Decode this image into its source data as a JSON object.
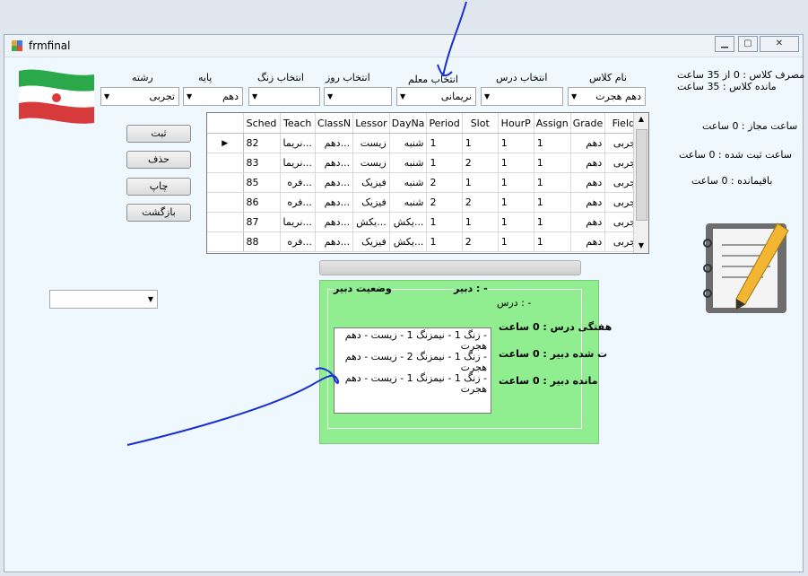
{
  "window": {
    "title": "frmfinal"
  },
  "top_labels": {
    "field": "رشته",
    "grade": "پایه",
    "bell": "انتخاب زنگ",
    "day": "انتخاب روز",
    "teacher": "انتخاب معلم",
    "lesson": "انتخاب درس",
    "class_name": "نام کلاس"
  },
  "combos": {
    "field": "تجربی",
    "grade": "دهم",
    "bell": "",
    "day": "",
    "teacher": "نریمانی",
    "lesson": "",
    "class_name": "دهم هجرت",
    "left_bottom": ""
  },
  "info": {
    "usage": "مصرف کلاس : 0 از 35 ساعت",
    "remaining_class": "مانده کلاس : 35 ساعت",
    "allowed_hours": "ساعت مجاز : 0 ساعت",
    "registered_hours": "ساعت ثبت شده : 0 ساعت",
    "remaining_hours": "باقیمانده : 0 ساعت"
  },
  "buttons": {
    "save": "ثبت",
    "delete": "حذف",
    "print": "چاپ",
    "back": "بازگشت"
  },
  "grid": {
    "columns": [
      "Sched",
      "Teach",
      "ClassN",
      "Lessor",
      "DayNa",
      "Period",
      "Slot",
      "HourP",
      "Assign",
      "Grade",
      "Field"
    ],
    "rows": [
      [
        "82",
        "...نریما",
        "...دهم",
        "زیست",
        "شنبه",
        "1",
        "1",
        "1",
        "1",
        "دهم",
        "تجربی"
      ],
      [
        "83",
        "...نریما",
        "...دهم",
        "زیست",
        "شنبه",
        "1",
        "2",
        "1",
        "1",
        "دهم",
        "تجربی"
      ],
      [
        "85",
        "...فره",
        "...دهم",
        "فیزیک",
        "شنبه",
        "2",
        "1",
        "1",
        "1",
        "دهم",
        "تجربی"
      ],
      [
        "86",
        "...فره",
        "...دهم",
        "فیزیک",
        "شنبه",
        "2",
        "2",
        "1",
        "1",
        "دهم",
        "تجربی"
      ],
      [
        "87",
        "...نریما",
        "...دهم",
        "...یکش",
        "...یکش",
        "1",
        "1",
        "1",
        "1",
        "دهم",
        "تجربی"
      ],
      [
        "88",
        "...فره",
        "...دهم",
        "فیزیک",
        "...یکش",
        "1",
        "2",
        "1",
        "1",
        "دهم",
        "تجربی"
      ]
    ]
  },
  "status_panel": {
    "teacher_status_title": "وضعیت دبیر",
    "teacher_label": "- : دبیر",
    "lesson_label": "- : درس",
    "weekly_lesson": "هفتگی درس : 0 ساعت",
    "teacher_registered": "ت شده دبیر : 0 ساعت",
    "teacher_remaining": "مانده دبیر : 0 ساعت",
    "list_items": [
      "- زنگ 1 - نیمزنگ 1 - زیست - دهم هجرت",
      "- زنگ 1 - نیمزنگ 2 - زیست - دهم هجرت",
      "- زنگ 1 - نیمزنگ 1 - زیست - دهم هجرت"
    ]
  },
  "icons": {
    "app": "form-icon",
    "flag": "iran-flag-icon",
    "notebook": "notebook-pencil-icon"
  }
}
